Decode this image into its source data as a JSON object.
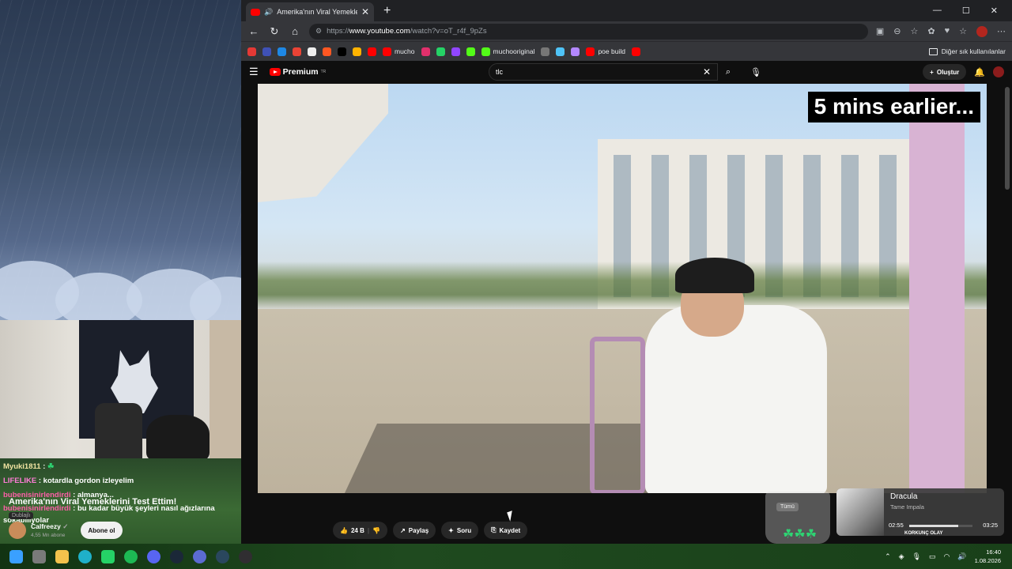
{
  "browser": {
    "tab_title": "Amerika'nın Viral Yemeklerini",
    "tab_close": "✕",
    "new_tab": "+",
    "url_prefix": "https://",
    "url_domain": "www.youtube.com",
    "url_path": "/watch?v=oT_r4f_9pZs",
    "window_controls": [
      "—",
      "☐",
      "✕"
    ],
    "nav_icons": [
      "←",
      "↻",
      "⌂"
    ],
    "bookmarks": [
      {
        "label": "",
        "color": "#e53935"
      },
      {
        "label": "",
        "color": "#3f51b5"
      },
      {
        "label": "",
        "color": "#1e88e5"
      },
      {
        "label": "",
        "color": "#ea4335"
      },
      {
        "label": "",
        "color": "#eeeeee"
      },
      {
        "label": "",
        "color": "#ff5722"
      },
      {
        "label": "",
        "color": "#000000"
      },
      {
        "label": "",
        "color": "#ffb300"
      },
      {
        "label": "",
        "color": "#ff0000"
      },
      {
        "label": "mucho",
        "color": "#ff0000"
      },
      {
        "label": "",
        "color": "#e1306c"
      },
      {
        "label": "",
        "color": "#25d366"
      },
      {
        "label": "",
        "color": "#9146ff"
      },
      {
        "label": "",
        "color": "#53fc18"
      },
      {
        "label": "muchooriginal",
        "color": "#53fc18"
      },
      {
        "label": "",
        "color": "#777777"
      },
      {
        "label": "",
        "color": "#4fc3f7"
      },
      {
        "label": "",
        "color": "#b388ff"
      },
      {
        "label": "poe build",
        "color": "#ff0000"
      },
      {
        "label": "",
        "color": "#ff0000"
      }
    ],
    "other_bookmarks": "Diğer sık kullanılanlar"
  },
  "youtube": {
    "logo": "Premium",
    "logo_tr": "TR",
    "search_value": "tlc",
    "create_label": "Oluştur",
    "video_caption": "5 mins earlier...",
    "video_title": "Amerika'nın Viral Yemeklerini Test Ettim!",
    "dub_badge": "Dublajlı",
    "channel_name": "Calfreezy",
    "channel_subs": "4,55 Mn abone",
    "subscribe_label": "Abone ol",
    "like_count": "24 B",
    "share_label": "Paylaş",
    "ask_label": "Soru",
    "save_label": "Kaydet"
  },
  "chat": [
    {
      "user": "Myuki1811",
      "text": ":",
      "cls": "u1"
    },
    {
      "user": "LIFELIKE",
      "text": ": kotardla gordon izleyelim",
      "cls": "u2"
    },
    {
      "user": "bubenisinirlendirdi",
      "text": ": almanya...",
      "cls": "u3"
    },
    {
      "user": "bubenisinirlendirdi",
      "text": ": bu kadar büyük şeyleri nasıl ağızlarına sokabiliyolar",
      "cls": "u3"
    }
  ],
  "widget": {
    "cup_label": "Tümü",
    "music_title": "Dracula",
    "music_artist": "Tame Impala",
    "time_current": "02:55",
    "time_total": "03:25",
    "progress": 0.78,
    "alert_label": "KORKUNÇ OLAY"
  },
  "taskbar": {
    "time": "16:40",
    "date": "1.08.2026"
  }
}
